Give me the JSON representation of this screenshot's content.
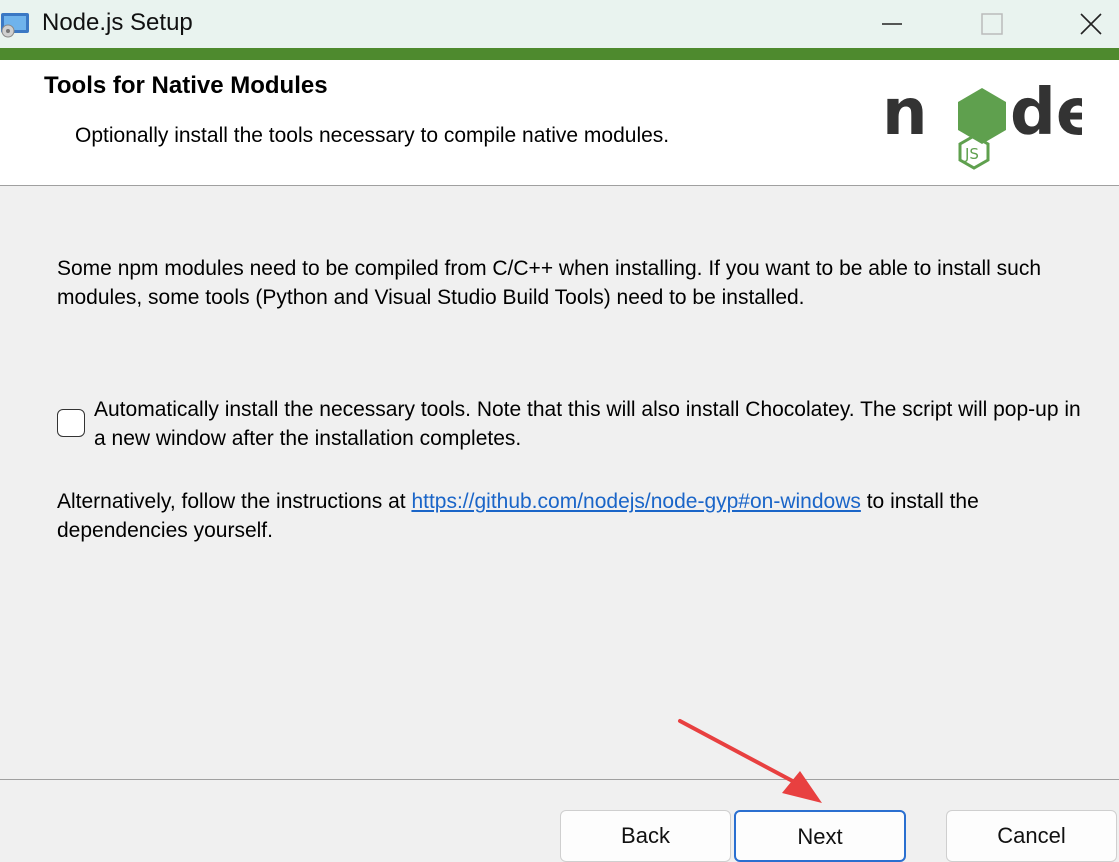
{
  "window": {
    "title": "Node.js Setup",
    "controls": [
      "minimize",
      "maximize",
      "close"
    ]
  },
  "header": {
    "title": "Tools for Native Modules",
    "subtitle": "Optionally install the tools necessary to compile native modules.",
    "logo_text": "node js"
  },
  "content": {
    "description": "Some npm modules need to be compiled from C/C++ when installing. If you want to be able to install such modules, some tools (Python and Visual Studio Build Tools) need to be installed.",
    "checkbox": {
      "label": "Automatically install the necessary tools. Note that this will also install Chocolatey. The script will pop-up in a new window after the installation completes.",
      "checked": false
    },
    "alternative": {
      "prefix": "Alternatively, follow the instructions at ",
      "link": "https://github.com/nodejs/node-gyp#on-windows",
      "suffix": " to install the dependencies yourself."
    }
  },
  "footer": {
    "back_label": "Back",
    "next_label": "Next",
    "cancel_label": "Cancel"
  },
  "annotation": {
    "arrow_color": "#e84040",
    "points_to": "next-button"
  },
  "colors": {
    "accent_green": "#4e8a2e",
    "link": "#1a65c8",
    "focus_border": "#2a6fd0"
  }
}
